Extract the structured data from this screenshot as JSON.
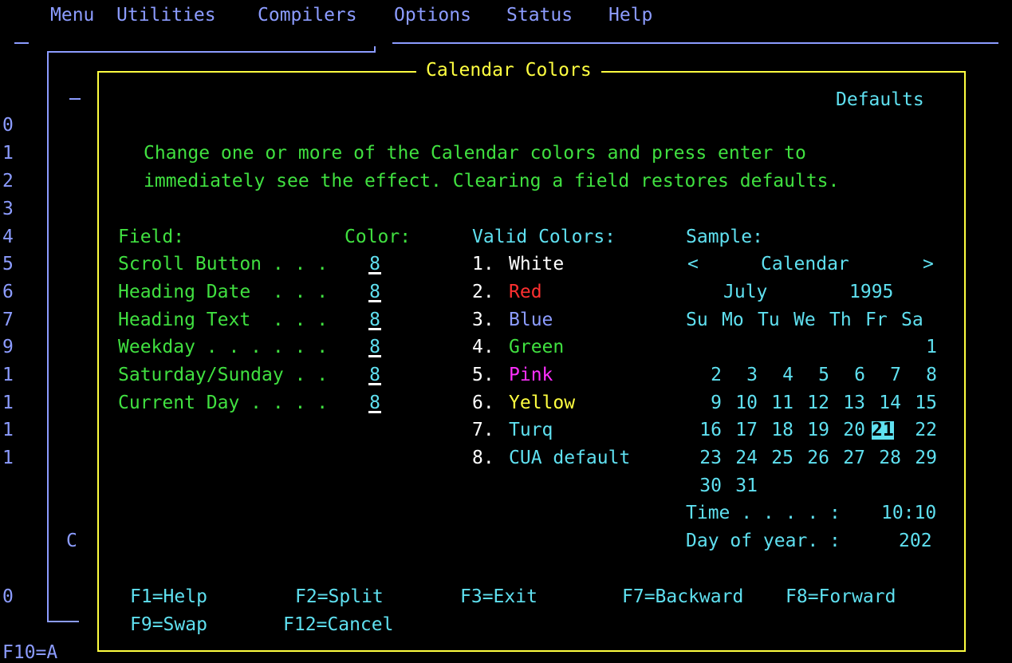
{
  "menubar": [
    "Menu",
    "Utilities",
    "Compilers",
    "Options",
    "Status",
    "Help"
  ],
  "background": {
    "left_numbers": [
      "0",
      "1",
      "2",
      "3",
      "4",
      "5",
      "6",
      "7",
      "9",
      "1",
      "1",
      "1",
      "1"
    ],
    "c_label": "C",
    "bottom_zero": "0",
    "bottom_fkey": "F10=A",
    "dash": "—"
  },
  "dialog": {
    "title": "Calendar Colors",
    "defaults": "Defaults",
    "instructions": [
      "Change one or more of the Calendar colors and press enter to",
      "immediately see the effect. Clearing a field restores defaults."
    ],
    "field_header": "Field:",
    "color_header": "Color:",
    "fields": [
      {
        "label": "Scroll Button . . .",
        "value": "8"
      },
      {
        "label": "Heading Date  . . .",
        "value": "8"
      },
      {
        "label": "Heading Text  . . .",
        "value": "8"
      },
      {
        "label": "Weekday . . . . . .",
        "value": "8"
      },
      {
        "label": "Saturday/Sunday . .",
        "value": "8"
      },
      {
        "label": "Current Day . . . .",
        "value": "8"
      }
    ],
    "valid_colors_header": "Valid Colors:",
    "valid_colors": [
      {
        "num": "1.",
        "name": "White",
        "color": "#ffffff"
      },
      {
        "num": "2.",
        "name": "Red",
        "color": "#ff3030"
      },
      {
        "num": "3.",
        "name": "Blue",
        "color": "#8c9cff"
      },
      {
        "num": "4.",
        "name": "Green",
        "color": "#40e040"
      },
      {
        "num": "5.",
        "name": "Pink",
        "color": "#ff30ff"
      },
      {
        "num": "6.",
        "name": "Yellow",
        "color": "#ffff40"
      },
      {
        "num": "7.",
        "name": "Turq",
        "color": "#5fe0f0"
      },
      {
        "num": "8.",
        "name": "CUA default",
        "color": "#5fe0f0"
      }
    ],
    "sample": {
      "header": "Sample:",
      "prev": "<",
      "next": ">",
      "calendar_label": "Calendar",
      "month": "July",
      "year": "1995",
      "weekdays": [
        "Su",
        "Mo",
        "Tu",
        "We",
        "Th",
        "Fr",
        "Sa"
      ],
      "weeks": [
        [
          "",
          "",
          "",
          "",
          "",
          "",
          "1"
        ],
        [
          "2",
          "3",
          "4",
          "5",
          "6",
          "7",
          "8"
        ],
        [
          "9",
          "10",
          "11",
          "12",
          "13",
          "14",
          "15"
        ],
        [
          "16",
          "17",
          "18",
          "19",
          "20",
          "21",
          "22"
        ],
        [
          "23",
          "24",
          "25",
          "26",
          "27",
          "28",
          "29"
        ],
        [
          "30",
          "31",
          "",
          "",
          "",
          "",
          ""
        ]
      ],
      "today": "21",
      "time_label": "Time . . . . :",
      "time_value": "10:10",
      "doy_label": "Day of year. :",
      "doy_value": "202"
    },
    "function_keys": [
      {
        "label": "F1=Help"
      },
      {
        "label": "F2=Split"
      },
      {
        "label": "F3=Exit"
      },
      {
        "label": "F7=Backward"
      },
      {
        "label": "F8=Forward"
      },
      {
        "label": "F9=Swap"
      },
      {
        "label": "F12=Cancel"
      }
    ]
  }
}
